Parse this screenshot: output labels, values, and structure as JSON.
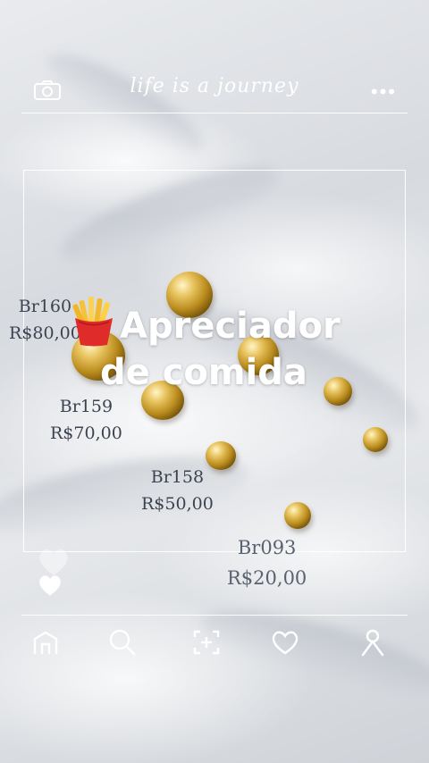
{
  "header": {
    "brand_text": "life is a journey",
    "camera_icon": "camera-icon",
    "more_icon": "more-options-icon",
    "more_glyph": "•••"
  },
  "post": {
    "title_line1": "Apreciador",
    "title_line2": "de comida",
    "title_emoji_icon": "french-fries-icon",
    "products": [
      {
        "code": "Br160",
        "price": "R$80,00"
      },
      {
        "code": "Br159",
        "price": "R$70,00"
      },
      {
        "code": "Br158",
        "price": "R$50,00"
      },
      {
        "code": "Br093",
        "price": "R$20,00"
      }
    ]
  },
  "actions": {
    "like_icon": "heart-icon"
  },
  "nav": {
    "items": [
      {
        "icon": "home-icon"
      },
      {
        "icon": "search-icon"
      },
      {
        "icon": "add-post-icon"
      },
      {
        "icon": "heart-icon"
      },
      {
        "icon": "profile-icon"
      }
    ]
  },
  "colors": {
    "line": "#ffffff",
    "caption_text": "#3b4250",
    "title_text": "#ffffff"
  }
}
